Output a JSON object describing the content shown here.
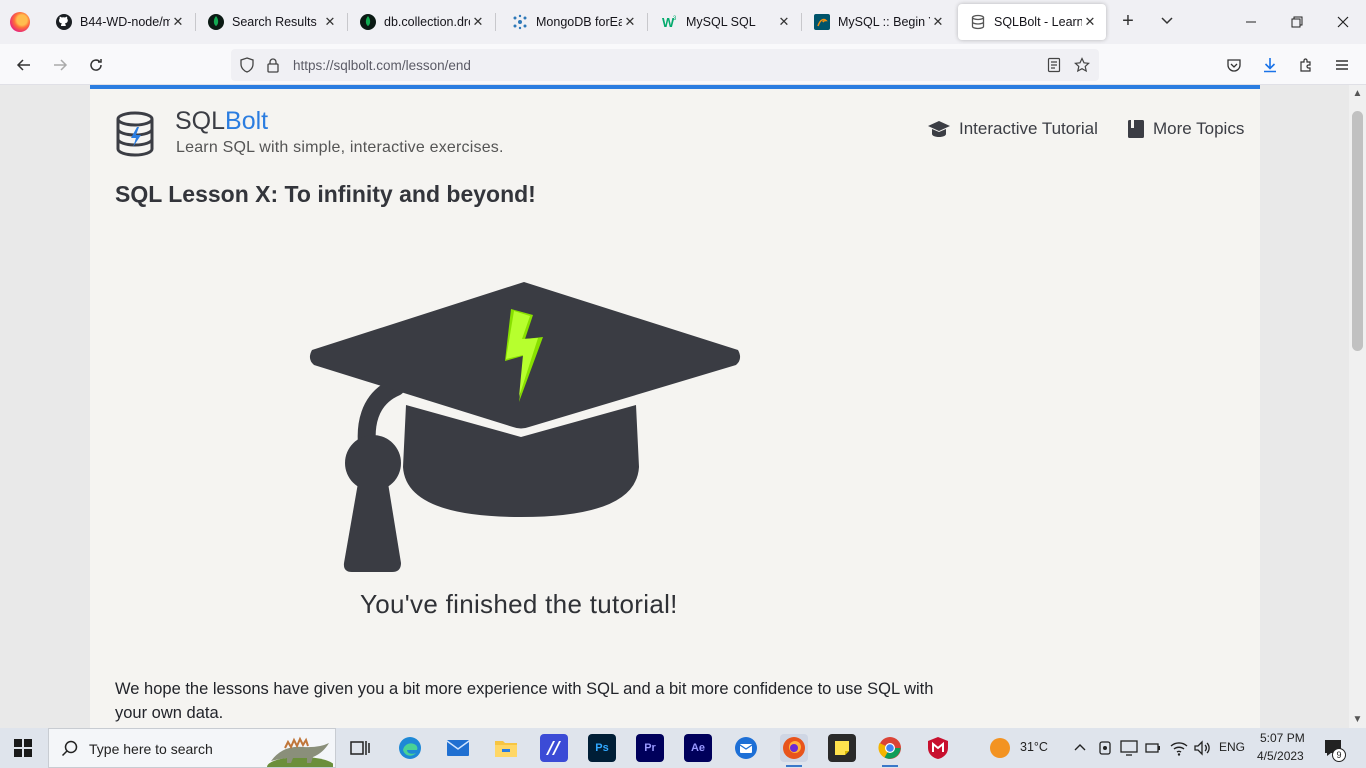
{
  "browser": {
    "tabs": [
      {
        "label": "B44-WD-node/m",
        "icon": "github-icon"
      },
      {
        "label": "Search Results",
        "icon": "mongodb-icon"
      },
      {
        "label": "db.collection.drop",
        "icon": "mongodb-icon"
      },
      {
        "label": "MongoDB forEach",
        "icon": "atom-icon"
      },
      {
        "label": "MySQL SQL",
        "icon": "w3schools-icon"
      },
      {
        "label": "MySQL :: Begin Yo",
        "icon": "mysql-icon"
      },
      {
        "label": "SQLBolt - Learn S",
        "icon": "database-icon",
        "active": true
      }
    ],
    "url_host": "https://sqlbolt.com",
    "url_path": "/lesson/end"
  },
  "site": {
    "brand_prefix": "SQL",
    "brand_suffix": "Bolt",
    "tagline": "Learn SQL with simple, interactive exercises.",
    "nav": {
      "tutorial": "Interactive Tutorial",
      "topics": "More Topics"
    },
    "accent_color": "#2b7de0"
  },
  "lesson": {
    "title": "SQL Lesson X: To infinity and beyond!",
    "finished_caption": "You've finished the tutorial!",
    "paragraph": "We hope the lessons have given you a bit more experience with SQL and a bit more confidence to use SQL with your own data."
  },
  "taskbar": {
    "search_placeholder": "Type here to search",
    "weather": "31°C",
    "language": "ENG",
    "time": "5:07 PM",
    "date": "4/5/2023",
    "notification_count": "9"
  }
}
